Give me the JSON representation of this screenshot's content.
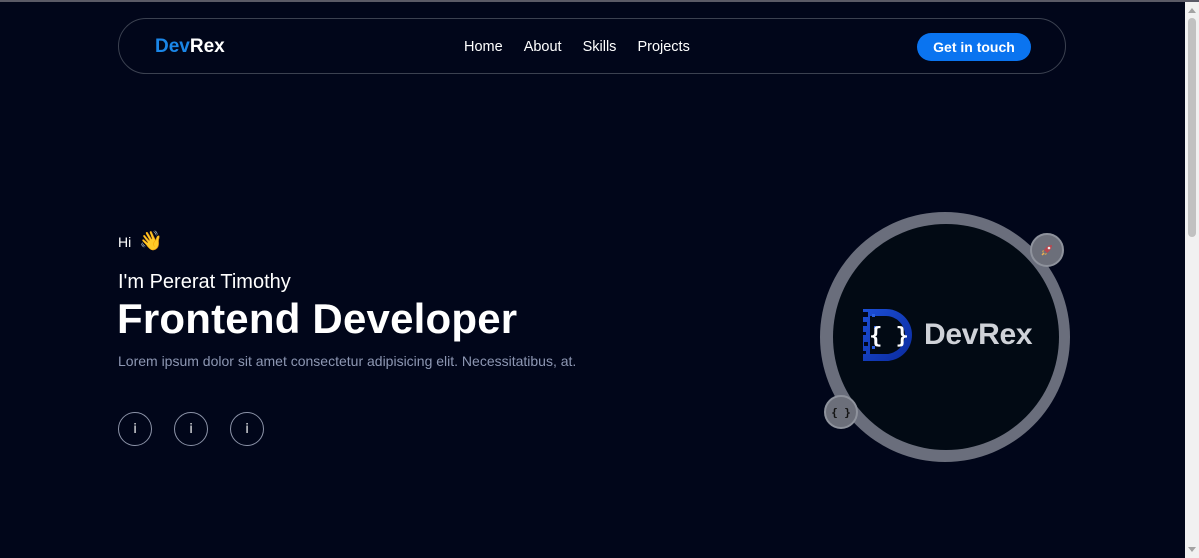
{
  "nav": {
    "brand_part1": "Dev",
    "brand_part2": "Rex",
    "links": [
      "Home",
      "About",
      "Skills",
      "Projects"
    ],
    "cta_label": "Get in touch"
  },
  "hero": {
    "greeting": "Hi",
    "wave_emoji": "👋",
    "intro": "I'm Pererat Timothy",
    "role": "Frontend Developer",
    "description": "Lorem ipsum dolor sit amet consectetur adipisicing elit. Necessitatibus, at.",
    "socials": [
      {
        "label": "i",
        "icon": "social-icon"
      },
      {
        "label": "i",
        "icon": "social-icon"
      },
      {
        "label": "i",
        "icon": "social-icon"
      }
    ]
  },
  "logo": {
    "text": "DevRex",
    "badges": [
      {
        "icon": "rocket-icon"
      },
      {
        "icon": "code-braces-icon",
        "label": "{ }"
      }
    ]
  },
  "colors": {
    "background": "#01061a",
    "accent": "#0a74f0",
    "brand_blue": "#1a86e8",
    "muted_text": "#8d97b3"
  }
}
